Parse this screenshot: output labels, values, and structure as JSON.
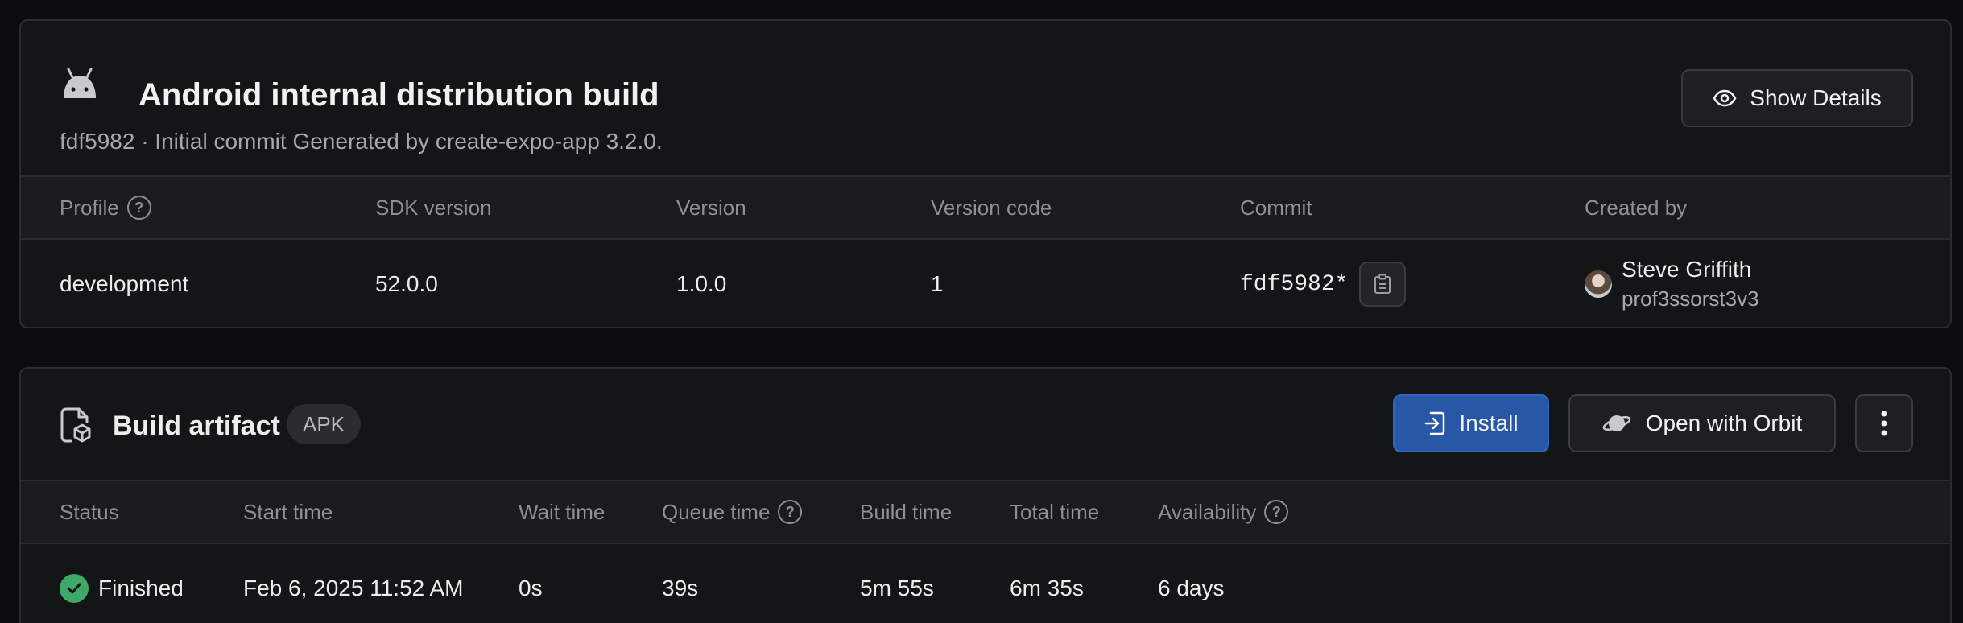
{
  "build": {
    "title": "Android internal distribution build",
    "subtitle": "fdf5982 · Initial commit Generated by create-expo-app 3.2.0.",
    "show_details_label": "Show Details",
    "columns": [
      "Profile",
      "SDK version",
      "Version",
      "Version code",
      "Commit",
      "Created by"
    ],
    "values": {
      "profile": "development",
      "sdk_version": "52.0.0",
      "version": "1.0.0",
      "version_code": "1",
      "commit": "fdf5982*",
      "creator_name": "Steve Griffith",
      "creator_username": "prof3ssorst3v3"
    }
  },
  "artifact": {
    "title": "Build artifact",
    "badge": "APK",
    "install_label": "Install",
    "orbit_label": "Open with Orbit",
    "columns": [
      "Status",
      "Start time",
      "Wait time",
      "Queue time",
      "Build time",
      "Total time",
      "Availability"
    ],
    "values": {
      "status": "Finished",
      "start_time": "Feb 6, 2025 11:52 AM",
      "wait_time": "0s",
      "queue_time": "39s",
      "build_time": "5m 55s",
      "total_time": "6m 35s",
      "availability": "6 days"
    }
  },
  "icons": {
    "android": "android-icon",
    "eye": "eye-icon",
    "help": "help-circle-icon",
    "clipboard": "clipboard-icon",
    "artifact": "file-box-icon",
    "install": "install-icon",
    "orbit": "planet-icon",
    "more": "more-vertical-icon",
    "status": "check-circle-icon"
  },
  "colors": {
    "background": "#0b0c0e",
    "card": "#141517",
    "install_button": "#2857a8",
    "success": "#3fa96a"
  }
}
